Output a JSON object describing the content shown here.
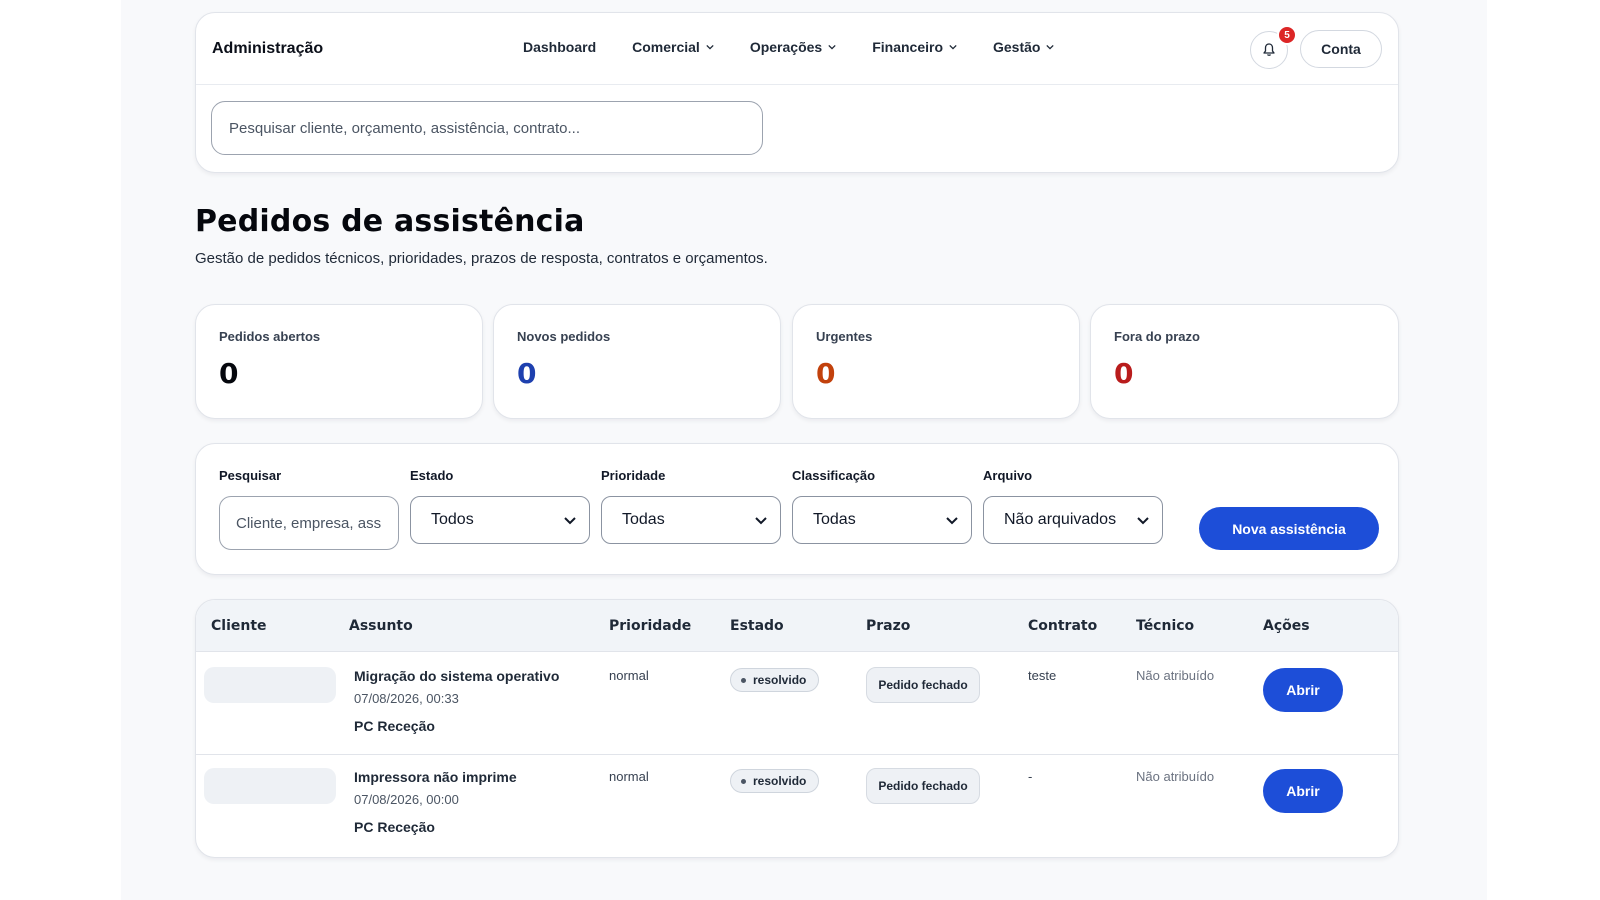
{
  "header": {
    "brand": "Administração",
    "nav": [
      {
        "label": "Dashboard",
        "dropdown": false
      },
      {
        "label": "Comercial",
        "dropdown": true
      },
      {
        "label": "Operações",
        "dropdown": true
      },
      {
        "label": "Financeiro",
        "dropdown": true
      },
      {
        "label": "Gestão",
        "dropdown": true
      }
    ],
    "notifications_count": "5",
    "account_label": "Conta",
    "search_placeholder": "Pesquisar cliente, orçamento, assistência, contrato..."
  },
  "page": {
    "title": "Pedidos de assistência",
    "subtitle": "Gestão de pedidos técnicos, prioridades, prazos de resposta, contratos e orçamentos."
  },
  "stats": [
    {
      "label": "Pedidos abertos",
      "value": "0",
      "color": "#05070d"
    },
    {
      "label": "Novos pedidos",
      "value": "0",
      "color": "#1e40af"
    },
    {
      "label": "Urgentes",
      "value": "0",
      "color": "#c2410c"
    },
    {
      "label": "Fora do prazo",
      "value": "0",
      "color": "#b91c1c"
    }
  ],
  "filters": {
    "search_label": "Pesquisar",
    "search_placeholder": "Cliente, empresa, assunto...",
    "estado_label": "Estado",
    "estado_value": "Todos",
    "prioridade_label": "Prioridade",
    "prioridade_value": "Todas",
    "classificacao_label": "Classificação",
    "classificacao_value": "Todas",
    "arquivo_label": "Arquivo",
    "arquivo_value": "Não arquivados",
    "new_button": "Nova assistência"
  },
  "table": {
    "columns": [
      "Cliente",
      "Assunto",
      "Prioridade",
      "Estado",
      "Prazo",
      "Contrato",
      "Técnico",
      "Ações"
    ],
    "rows": [
      {
        "subject": "Migração do sistema operativo",
        "date": "07/08/2026, 00:33",
        "device": "PC Receção",
        "priority": "normal",
        "status": "resolvido",
        "deadline": "Pedido fechado",
        "contract": "teste",
        "technician": "Não atribuído",
        "action": "Abrir"
      },
      {
        "subject": "Impressora não imprime",
        "date": "07/08/2026, 00:00",
        "device": "PC Receção",
        "priority": "normal",
        "status": "resolvido",
        "deadline": "Pedido fechado",
        "contract": "-",
        "technician": "Não atribuído",
        "action": "Abrir"
      }
    ]
  },
  "colors": {
    "primary": "#1d4ed8",
    "notification_badge": "#dc2626"
  }
}
